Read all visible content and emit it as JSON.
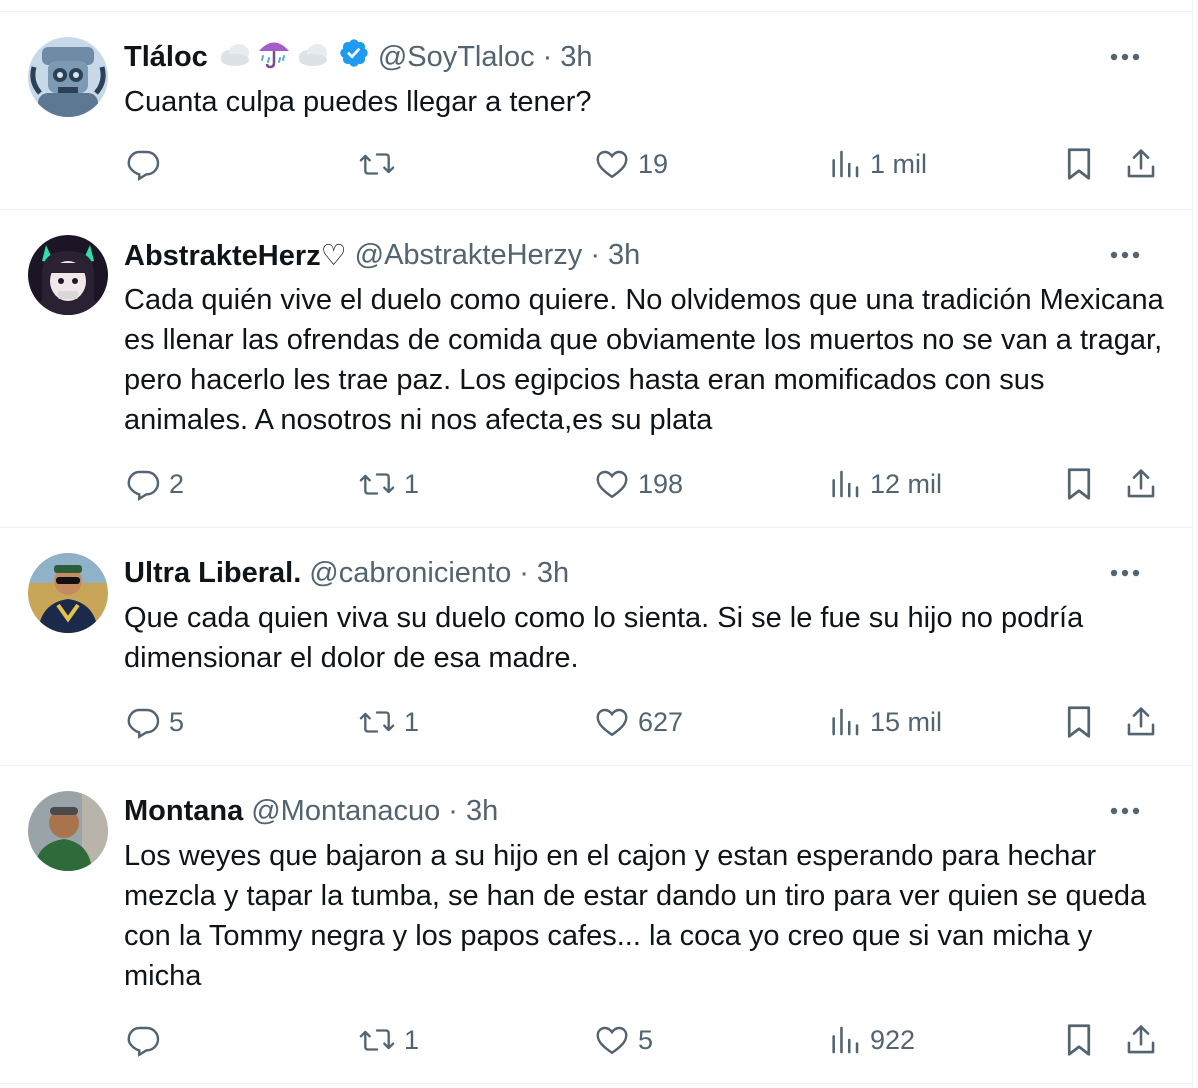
{
  "tweets": [
    {
      "name": "Tláloc",
      "handle": "@SoyTlaloc",
      "dot": "·",
      "time": "3h",
      "text": "Cuanta culpa puedes llegar a tener?",
      "replies": "",
      "retweets": "",
      "likes": "19",
      "views": "1 mil"
    },
    {
      "name": "AbstrakteHerz♡",
      "handle": "@AbstrakteHerzy",
      "dot": "·",
      "time": "3h",
      "text": "Cada quién vive el duelo como quiere. No olvidemos que una tradición Mexicana es llenar las ofrendas de comida que obviamente los muertos no se van a tragar, pero hacerlo les trae paz. Los egipcios hasta eran momificados con sus animales. A nosotros ni nos afecta,es su plata",
      "replies": "2",
      "retweets": "1",
      "likes": "198",
      "views": "12 mil"
    },
    {
      "name": "Ultra Liberal.",
      "handle": "@cabroniciento",
      "dot": "·",
      "time": "3h",
      "text": "Que cada quien viva su duelo como lo sienta. Si se le fue su hijo no podría dimensionar el dolor de esa madre.",
      "replies": "5",
      "retweets": "1",
      "likes": "627",
      "views": "15 mil"
    },
    {
      "name": "Montana",
      "handle": "@Montanacuo",
      "dot": "·",
      "time": "3h",
      "text": "Los weyes que bajaron a su hijo en el cajon y estan esperando para hechar mezcla y tapar la tumba, se han de estar dando un tiro para ver quien se queda con la Tommy negra y los papos cafes... la coca yo creo que si van micha y micha",
      "replies": "",
      "retweets": "1",
      "likes": "5",
      "views": "922"
    }
  ],
  "icons": {
    "reply": "reply-icon",
    "retweet": "retweet-icon",
    "like": "heart-icon",
    "views": "views-icon",
    "bookmark": "bookmark-icon",
    "share": "share-icon",
    "more": "more-icon",
    "verified": "verified-badge-icon",
    "name_emoji": [
      "cloud-icon",
      "umbrella-rain-icon",
      "cloud-icon"
    ]
  },
  "colors": {
    "text_primary": "#0f1419",
    "text_secondary": "#536471",
    "verified_blue": "#1d9bf0",
    "divider": "#eff3f4"
  }
}
